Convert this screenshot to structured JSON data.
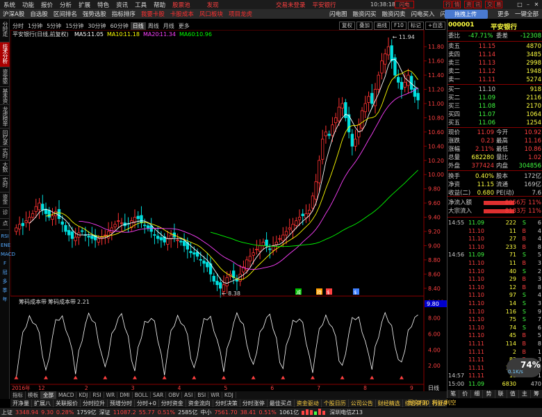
{
  "menu": {
    "items": [
      "系统",
      "功能",
      "报价",
      "分析",
      "扩展",
      "特色",
      "资讯",
      "工具",
      "帮助"
    ],
    "account_label": "股票池",
    "extra_label": "发现",
    "mid_links": [
      "交易未登录",
      "平安银行"
    ],
    "clock": "10:38:18",
    "win_buttons": [
      "闪电手",
      "行",
      "情",
      "资",
      "讯",
      "交",
      "易"
    ],
    "win_controls": [
      "□",
      "▭",
      "–",
      "✕"
    ]
  },
  "toolbar": {
    "items": [
      "沪深A股",
      "自选股",
      "区间排名",
      "强势选股",
      "指标排序"
    ],
    "red_items": [
      "我要卡股",
      "卡股成本",
      "风口板块",
      "项目龙虎"
    ],
    "right_tabs": [
      "闪电图",
      "融资闪买",
      "融资闪卖",
      "闪电买入",
      "闪电卖出"
    ],
    "upload_label": "拖拽上传",
    "right_links": [
      "更多",
      "一键全部"
    ]
  },
  "side_tabs": [
    "分时走势",
    "技术分析",
    "资金驱动",
    "基本资料",
    "龙虎榜单",
    "回忆录",
    "实时10",
    "大数据",
    "实时分时",
    "资金研报",
    "诊断",
    "点评"
  ],
  "side_tabs_active": 1,
  "side_icons": [
    "RSI",
    "ENE",
    "MACD",
    "F",
    "冠",
    "多",
    "季",
    "年"
  ],
  "period": {
    "items": [
      "分时",
      "1分钟",
      "5分钟",
      "15分钟",
      "30分钟",
      "60分钟",
      "日线",
      "周线",
      "月线",
      "更多"
    ],
    "active": "日线",
    "tools": [
      "复权",
      "叠加",
      "画线",
      "F10",
      "标记",
      "+自选",
      "返回"
    ]
  },
  "chart_data": [
    {
      "type": "line",
      "title": "平安银行(日线,前复权)",
      "indicators": [
        {
          "name": "MA5",
          "value": "11.05",
          "color": "#ffffff"
        },
        {
          "name": "MA10",
          "value": "11.18",
          "color": "#ffff00"
        },
        {
          "name": "MA20",
          "value": "11.34",
          "color": "#ff40ff"
        },
        {
          "name": "MA60",
          "value": "10.96",
          "color": "#00ff00"
        }
      ],
      "ylim": [
        8.3,
        11.9
      ],
      "y_ticks": [
        "11.80",
        "11.60",
        "11.40",
        "11.20",
        "11.00",
        "10.80",
        "10.60",
        "10.40",
        "10.20",
        "10.00",
        "9.80",
        "9.60",
        "9.40",
        "9.20",
        "9.00",
        "8.80",
        "8.60",
        "8.40"
      ],
      "annotations": [
        {
          "label": "11.94",
          "position": "high"
        },
        {
          "label": "8.38",
          "position": "low"
        }
      ],
      "x_ticks": [
        "2016年",
        "12",
        "2",
        "3",
        "4",
        "5",
        "6",
        "7",
        "8",
        "9"
      ],
      "period_label": "日线",
      "markers": [
        "减",
        "持",
        "$",
        "$"
      ],
      "series_close": [
        9.25,
        9.3,
        9.28,
        9.35,
        9.4,
        9.45,
        9.55,
        9.6,
        9.5,
        9.45,
        9.4,
        9.42,
        9.48,
        9.38,
        9.3,
        9.2,
        9.15,
        9.1,
        9.12,
        9.18,
        9.2,
        9.15,
        9.12,
        9.1,
        9.08,
        9.1,
        9.12,
        9.15,
        9.2,
        9.25,
        9.3,
        9.35,
        9.32,
        9.28,
        9.3,
        9.35,
        9.4,
        9.38,
        9.32,
        9.28,
        9.25,
        9.2,
        9.15,
        9.1,
        9.08,
        9.05,
        9.1,
        9.15,
        9.12,
        9.08,
        9.05,
        9.0,
        8.95,
        8.9,
        8.88,
        8.85,
        8.8,
        8.75,
        8.7,
        8.6,
        8.5,
        8.45,
        8.4,
        8.45,
        8.55,
        8.6,
        8.55,
        8.5,
        8.6,
        8.7,
        8.8,
        8.85,
        8.9,
        8.95,
        9.0,
        9.05,
        9.0,
        8.95,
        9.0,
        9.05,
        9.1,
        9.15,
        9.2,
        9.25,
        9.3,
        9.35,
        9.4,
        9.42,
        9.45,
        9.5,
        9.7,
        9.9,
        10.2,
        10.5,
        10.6,
        10.55,
        10.7,
        10.8,
        10.95,
        11.0,
        10.8,
        10.6,
        10.4,
        10.5,
        10.7,
        10.9,
        11.0,
        11.1,
        11.0,
        11.2,
        11.4,
        11.6,
        11.7,
        11.8,
        11.6,
        11.4,
        11.3,
        11.2,
        11.3,
        11.4,
        11.2,
        11.1,
        11.05
      ]
    },
    {
      "type": "line",
      "title": "筹码成本带",
      "subtitle": "筹码成本带",
      "value_label": "2.21",
      "current_value": "9.80",
      "ylim": [
        0,
        10.5
      ],
      "y_ticks": [
        "10.00",
        "8.00",
        "6.00",
        "4.00",
        "2.00"
      ]
    }
  ],
  "quote": {
    "code": "000001",
    "name": "平安银行",
    "wei_bi_label": "委比",
    "wei_bi": "-47.71%",
    "wei_cha_label": "委差",
    "wei_cha": "-12308",
    "asks": [
      {
        "label": "卖五",
        "price": "11.15",
        "vol": "4870"
      },
      {
        "label": "卖四",
        "price": "11.14",
        "vol": "3485"
      },
      {
        "label": "卖三",
        "price": "11.13",
        "vol": "2998"
      },
      {
        "label": "卖二",
        "price": "11.12",
        "vol": "1948"
      },
      {
        "label": "卖一",
        "price": "11.11",
        "vol": "5274"
      }
    ],
    "bids": [
      {
        "label": "买一",
        "price": "11.10",
        "vol": "918"
      },
      {
        "label": "买二",
        "price": "11.09",
        "vol": "2116"
      },
      {
        "label": "买三",
        "price": "11.08",
        "vol": "2170"
      },
      {
        "label": "买四",
        "price": "11.07",
        "vol": "1064"
      },
      {
        "label": "买五",
        "price": "11.06",
        "vol": "1254"
      }
    ],
    "stats": [
      {
        "l1": "现价",
        "v1": "11.09",
        "l2": "今开",
        "v2": "10.92"
      },
      {
        "l1": "涨跌",
        "v1": "0.23",
        "l2": "最高",
        "v2": "11.16"
      },
      {
        "l1": "涨幅",
        "v1": "2.11%",
        "l2": "最低",
        "v2": "10.86"
      },
      {
        "l1": "总量",
        "v1": "682280",
        "l2": "量比",
        "v2": "1.02"
      },
      {
        "l1": "外盘",
        "v1": "377424",
        "l2": "内盘",
        "v2": "304856"
      },
      {
        "l1": "换手",
        "v1": "0.40%",
        "l2": "股本",
        "v2": "172亿"
      },
      {
        "l1": "净资",
        "v1": "11.15",
        "l2": "流通",
        "v2": "169亿"
      },
      {
        "l1": "收益(二)",
        "v1": "0.680",
        "l2": "PE(动)",
        "v2": "7.6"
      }
    ],
    "flows": [
      {
        "label": "净流入额",
        "value": "8056万",
        "pct": "11%"
      },
      {
        "label": "大宗流入",
        "value": "8133万",
        "pct": "11%"
      }
    ],
    "ticks": [
      {
        "time": "14:55",
        "price": "11.09",
        "vol": "222",
        "bs": "S",
        "n": "6"
      },
      {
        "time": "",
        "price": "11.10",
        "vol": "11",
        "bs": "B",
        "n": "4"
      },
      {
        "time": "",
        "price": "11.10",
        "vol": "27",
        "bs": "B",
        "n": "4"
      },
      {
        "time": "",
        "price": "11.10",
        "vol": "233",
        "bs": "B",
        "n": "8"
      },
      {
        "time": "14:56",
        "price": "11.09",
        "vol": "71",
        "bs": "S",
        "n": "5"
      },
      {
        "time": "",
        "price": "11.10",
        "vol": "11",
        "bs": "B",
        "n": "3"
      },
      {
        "time": "",
        "price": "11.10",
        "vol": "40",
        "bs": "S",
        "n": "2"
      },
      {
        "time": "",
        "price": "11.10",
        "vol": "29",
        "bs": "B",
        "n": "3"
      },
      {
        "time": "",
        "price": "11.10",
        "vol": "12",
        "bs": "B",
        "n": "8"
      },
      {
        "time": "",
        "price": "11.10",
        "vol": "97",
        "bs": "S",
        "n": "4"
      },
      {
        "time": "",
        "price": "11.10",
        "vol": "14",
        "bs": "S",
        "n": "3"
      },
      {
        "time": "",
        "price": "11.10",
        "vol": "116",
        "bs": "S",
        "n": "9"
      },
      {
        "time": "",
        "price": "11.10",
        "vol": "75",
        "bs": "S",
        "n": "7"
      },
      {
        "time": "",
        "price": "11.10",
        "vol": "74",
        "bs": "S",
        "n": "6"
      },
      {
        "time": "",
        "price": "11.10",
        "vol": "45",
        "bs": "B",
        "n": "5"
      },
      {
        "time": "",
        "price": "11.11",
        "vol": "114",
        "bs": "B",
        "n": "8"
      },
      {
        "time": "",
        "price": "11.11",
        "vol": "2",
        "bs": "B",
        "n": "1"
      },
      {
        "time": "",
        "price": "11.11",
        "vol": "82",
        "bs": "B",
        "n": "3"
      },
      {
        "time": "",
        "price": "11.11",
        "vol": "173",
        "bs": "B",
        "n": "6"
      },
      {
        "time": "14:57",
        "price": "11.11",
        "vol": "11",
        "bs": "B",
        "n": "1"
      },
      {
        "time": "15:00",
        "price": "11.09",
        "vol": "6830",
        "bs": "",
        "n": "470"
      }
    ],
    "bottom_tabs": [
      "笔",
      "价",
      "细",
      "势",
      "联",
      "值",
      "主",
      "筹"
    ]
  },
  "bottom_tabs": {
    "row1": [
      "指标",
      "模板",
      "全部",
      "MACD",
      "KDJ",
      "RSI",
      "WR",
      "DMI",
      "BOLL",
      "SAR",
      "OBV",
      "ASI",
      "BSI",
      "WR",
      "KDJ"
    ],
    "row1_active": "全部",
    "row2": [
      "开净量",
      "扩展八",
      "关联报价",
      "分时拉升",
      "预增分时",
      "分时+0",
      "分时资金",
      "资金流向",
      "分时决策",
      "分时涨停",
      "最佳买点"
    ],
    "row2_hl": [
      "资金驱动",
      "个股日历",
      "公司公告",
      "财经精选",
      "综合资讯",
      "行业资讯"
    ],
    "right_labels": [
      "图文F10",
      "利好/利空"
    ]
  },
  "status": {
    "items": [
      {
        "label": "上证",
        "value": "3348.94",
        "chg": "9.30",
        "pct": "0.28%",
        "amt": "1759亿",
        "up": true
      },
      {
        "label": "深证",
        "value": "11087.2",
        "chg": "55.77",
        "pct": "0.51%",
        "amt": "2585亿",
        "up": true
      },
      {
        "label": "中小",
        "value": "7561.70",
        "chg": "38.41",
        "pct": "0.51%",
        "amt": "1061亿",
        "up": true
      }
    ],
    "network": "深圳电信Z13"
  },
  "float_badge": {
    "pct": "74%",
    "speed": "0.1K/s"
  },
  "colors": {
    "up": "#ff3232",
    "down": "#00e0e0",
    "grid": "#8b0000",
    "bg": "#000000"
  }
}
